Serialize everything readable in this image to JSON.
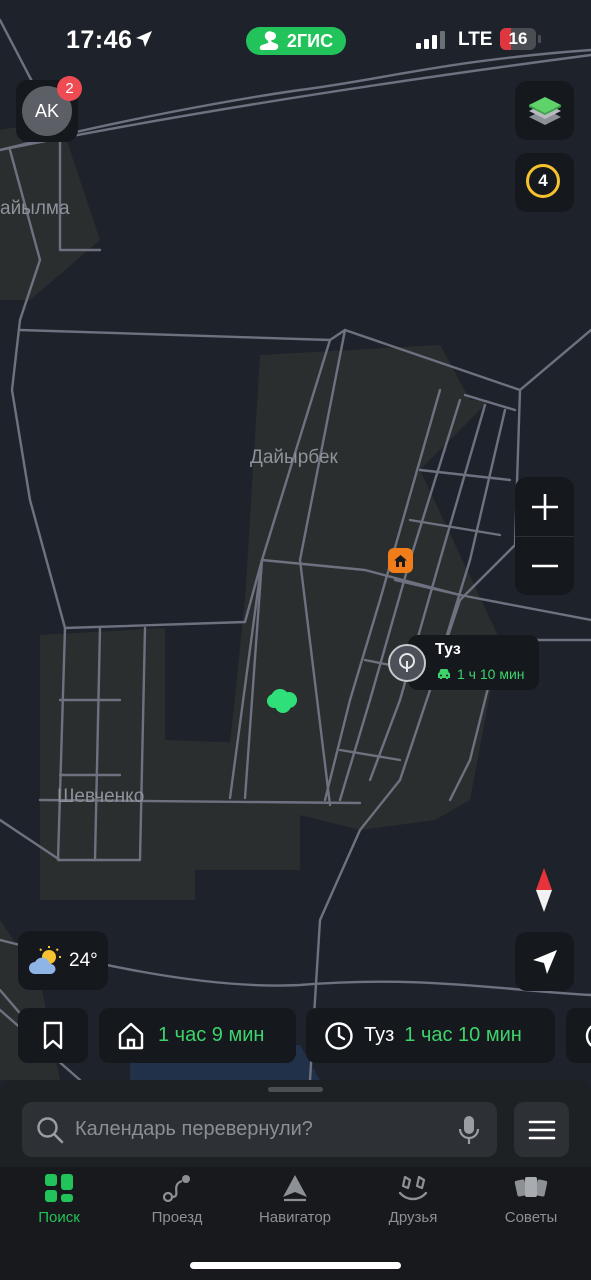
{
  "status_bar": {
    "time": "17:46",
    "network": "LTE",
    "battery": "16"
  },
  "brand": {
    "label": "2ГИС",
    "color": "#22c35a"
  },
  "profile": {
    "initials": "AK",
    "notifications": "2"
  },
  "controls": {
    "layers_icon": "layers-icon",
    "traffic_level": "4",
    "zoom_in_icon": "plus-icon",
    "zoom_out_icon": "minus-icon",
    "compass_icon": "compass-icon",
    "locate_icon": "navigation-arrow-icon"
  },
  "map": {
    "labels": {
      "top_left": "айылма",
      "village_center": "Дайырбек",
      "village_left": "Шевченко"
    },
    "poi": {
      "name": "Туз",
      "eta": "1 ч 10 мин"
    }
  },
  "weather": {
    "temperature": "24°",
    "icon": "partly-cloudy-icon"
  },
  "quick_routes": {
    "bookmark_icon": "bookmark-icon",
    "home": {
      "icon": "home-icon",
      "eta": "1 час 9 мин"
    },
    "recent": {
      "icon": "clock-icon",
      "name": "Туз",
      "eta": "1 час 10 мин"
    }
  },
  "search": {
    "placeholder": "Календарь перевернули?"
  },
  "tabs": [
    {
      "label": "Поиск",
      "active": true
    },
    {
      "label": "Проезд",
      "active": false
    },
    {
      "label": "Навигатор",
      "active": false
    },
    {
      "label": "Друзья",
      "active": false
    },
    {
      "label": "Советы",
      "active": false
    }
  ]
}
